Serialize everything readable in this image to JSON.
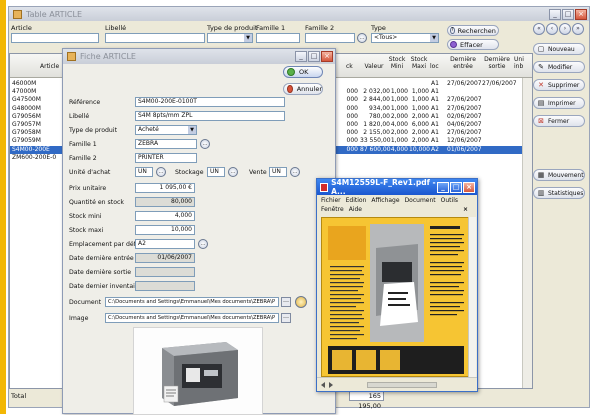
{
  "main_window": {
    "title": "Table ARTICLE",
    "filters": {
      "article_label": "Article",
      "libelle_label": "Libellé",
      "type_produit_label": "Type de produit",
      "famille1_label": "Famille 1",
      "famille2_label": "Famille 2",
      "type_label": "Type",
      "type_value": "<Tous>"
    },
    "buttons": {
      "rechercher": "Recherchen",
      "effacer": "Effacer",
      "nouveau": "Nouveau",
      "modifier": "Modifier",
      "supprimer": "Supprimer",
      "imprimer": "Imprimer",
      "fermer": "Fermer",
      "mouvement": "Mouvement",
      "statistiques": "Statistiques"
    },
    "grid": {
      "headers": [
        "Article",
        "ck",
        "Valeur",
        "Stock Mini",
        "Stock Maxi",
        "loc",
        "Dernière entrée",
        "Dernière sortie",
        "Uni inb"
      ],
      "rows": [
        {
          "article": "46000M",
          "ck": "",
          "valeur": "",
          "mini": "",
          "maxi": "",
          "loc": "A1",
          "entree": "27/06/2007",
          "sortie": "27/06/2007",
          "selected": false
        },
        {
          "article": "47000M",
          "ck": "000",
          "valeur": "2 032,00",
          "mini": "1,000",
          "maxi": "1,000",
          "loc": "A1",
          "entree": "",
          "sortie": "",
          "selected": false
        },
        {
          "article": "G47500M",
          "ck": "000",
          "valeur": "2 844,00",
          "mini": "1,000",
          "maxi": "1,000",
          "loc": "A1",
          "entree": "27/06/2007",
          "sortie": "",
          "selected": false
        },
        {
          "article": "G48000M",
          "ck": "000",
          "valeur": "934,00",
          "mini": "1,000",
          "maxi": "1,000",
          "loc": "A1",
          "entree": "27/06/2007",
          "sortie": "",
          "selected": false
        },
        {
          "article": "G79056M",
          "ck": "000",
          "valeur": "780,00",
          "mini": "2,000",
          "maxi": "2,000",
          "loc": "A1",
          "entree": "02/06/2007",
          "sortie": "",
          "selected": false
        },
        {
          "article": "G79057M",
          "ck": "000",
          "valeur": "1 820,00",
          "mini": "4,000",
          "maxi": "6,000",
          "loc": "A1",
          "entree": "04/06/2007",
          "sortie": "",
          "selected": false
        },
        {
          "article": "G79058M",
          "ck": "000",
          "valeur": "2 155,00",
          "mini": "2,000",
          "maxi": "2,000",
          "loc": "A1",
          "entree": "27/06/2007",
          "sortie": "",
          "selected": false
        },
        {
          "article": "G79059M",
          "ck": "000",
          "valeur": "33 550,00",
          "mini": "1,000",
          "maxi": "2,000",
          "loc": "A1",
          "entree": "12/06/2007",
          "sortie": "",
          "selected": false
        },
        {
          "article": "S4M00-200E",
          "ck": "000",
          "valeur": "87 600,00",
          "mini": "4,000",
          "maxi": "10,000",
          "loc": "A2",
          "entree": "01/06/2007",
          "sortie": "",
          "selected": true
        },
        {
          "article": "ZM600-200E-0",
          "ck": "",
          "valeur": "",
          "mini": "",
          "maxi": "",
          "loc": "",
          "entree": "",
          "sortie": "",
          "selected": false
        }
      ]
    },
    "total_label": "Total",
    "total_value": "165 195,00"
  },
  "fiche": {
    "title": "Fiche ARTICLE",
    "ok_label": "OK",
    "annuler_label": "Annuler",
    "fields": {
      "reference_label": "Référence",
      "reference_value": "S4M00-200E-0100T",
      "libelle_label": "Libellé",
      "libelle_value": "S4M 8pts/mm ZPL",
      "type_produit_label": "Type de produit",
      "type_produit_value": "Acheté",
      "famille1_label": "Famille 1",
      "famille1_value": "ZEBRA",
      "famille2_label": "Famille 2",
      "famille2_value": "PRINTER",
      "unite_achat_label": "Unité d'achat",
      "unite_achat_value": "UN",
      "stockage_label": "Stockage",
      "stockage_value": "UN",
      "vente_label": "Vente",
      "vente_value": "UN",
      "prix_unitaire_label": "Prix unitaire",
      "prix_unitaire_value": "1 095,00 €",
      "quantite_stock_label": "Quantité en stock",
      "quantite_stock_value": "80,000",
      "stock_mini_label": "Stock mini",
      "stock_mini_value": "4,000",
      "stock_maxi_label": "Stock maxi",
      "stock_maxi_value": "10,000",
      "emplacement_label": "Emplacement par défaut",
      "emplacement_value": "A2",
      "derniere_entree_label": "Date dernière entrée",
      "derniere_entree_value": "01/06/2007",
      "derniere_sortie_label": "Date dernière sortie",
      "derniere_sortie_value": "",
      "dernier_inventaire_label": "Date dernier inventaire",
      "dernier_inventaire_value": "",
      "document_label": "Document",
      "document_value": "C:\\Documents and Settings\\Emmanuel\\Mes documents\\ZEBRA\\P",
      "image_label": "Image",
      "image_value": "C:\\Documents and Settings\\Emmanuel\\Mes documents\\ZEBRA\\P"
    }
  },
  "pdf_window": {
    "title": "S4M12559L-F_Rev1.pdf - A...",
    "menu": [
      "Fichier",
      "Edition",
      "Affichage",
      "Document",
      "Outils",
      "Fenêtre",
      "Aide"
    ],
    "close_x": "×"
  },
  "colors": {
    "selection": "#316ac5",
    "pdf_title": "#1b56cf",
    "brand_yellow": "#f2b705"
  }
}
